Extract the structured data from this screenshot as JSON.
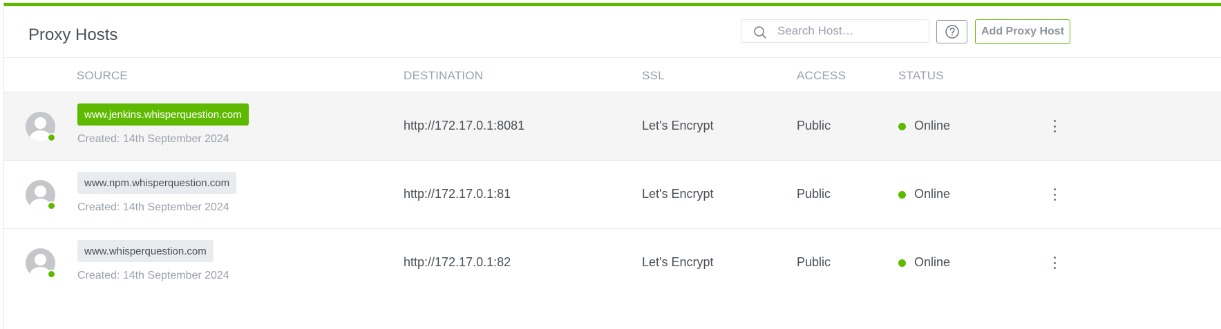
{
  "header": {
    "title": "Proxy Hosts",
    "search_placeholder": "Search Host…",
    "add_button_label": "Add Proxy Host"
  },
  "columns": [
    "SOURCE",
    "DESTINATION",
    "SSL",
    "ACCESS",
    "STATUS"
  ],
  "rows": [
    {
      "domain": "www.jenkins.whisperquestion.com",
      "created": "Created: 14th September 2024",
      "destination": "http://172.17.0.1:8081",
      "ssl": "Let's Encrypt",
      "access": "Public",
      "status": "Online"
    },
    {
      "domain": "www.npm.whisperquestion.com",
      "created": "Created: 14th September 2024",
      "destination": "http://172.17.0.1:81",
      "ssl": "Let's Encrypt",
      "access": "Public",
      "status": "Online"
    },
    {
      "domain": "www.whisperquestion.com",
      "created": "Created: 14th September 2024",
      "destination": "http://172.17.0.1:82",
      "ssl": "Let's Encrypt",
      "access": "Public",
      "status": "Online"
    }
  ],
  "icons": {
    "search": "search-icon",
    "help": "help-circle-icon",
    "avatar": "user-avatar-icon",
    "status": "status-dot-icon",
    "menu": "more-vertical-icon"
  },
  "colors": {
    "accent": "#5eba00",
    "row_highlight": "#f5f5f5",
    "muted_text": "#9aa0ac"
  }
}
